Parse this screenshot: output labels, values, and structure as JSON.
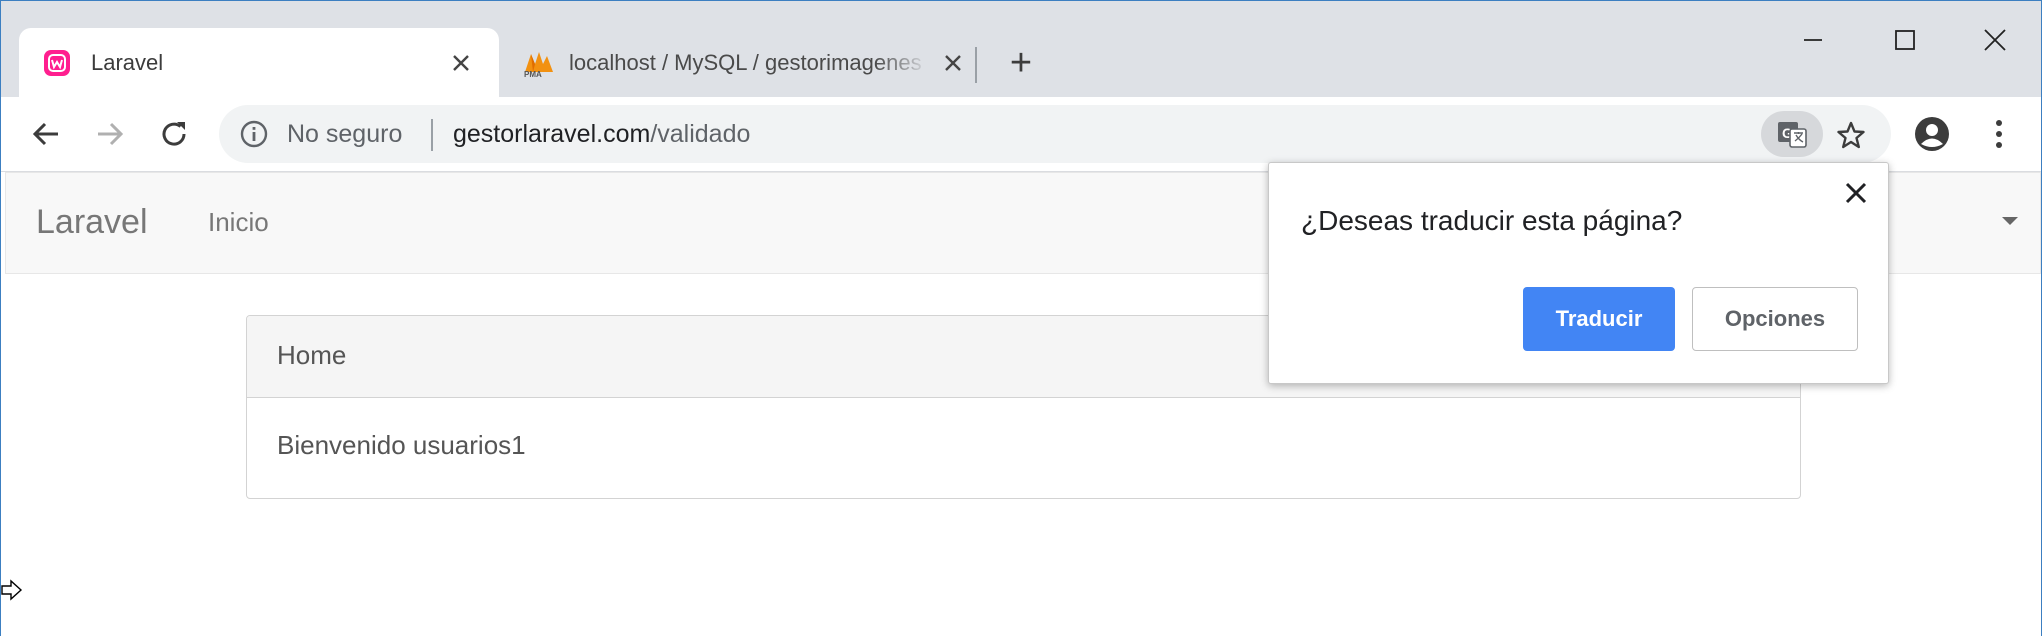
{
  "browser": {
    "tabs": [
      {
        "title": "Laravel",
        "favicon": "wampserver-icon",
        "active": true
      },
      {
        "title": "localhost / MySQL / gestorimagenes",
        "favicon": "phpmyadmin-icon",
        "active": false
      }
    ],
    "new_tab_label": "+",
    "omnibox": {
      "security_label": "No seguro",
      "url_host": "gestorlaravel.com",
      "url_path": "/validado"
    }
  },
  "page": {
    "navbar": {
      "brand": "Laravel",
      "links": [
        "Inicio"
      ]
    },
    "card": {
      "header": "Home",
      "body": "Bienvenido usuarios1"
    }
  },
  "translate_popup": {
    "question": "¿Deseas traducir esta página?",
    "translate_button": "Traducir",
    "options_button": "Opciones"
  },
  "colors": {
    "tabstrip_bg": "#dee1e6",
    "primary_button": "#4285f4",
    "favicon_pink": "#ff1f8f"
  }
}
